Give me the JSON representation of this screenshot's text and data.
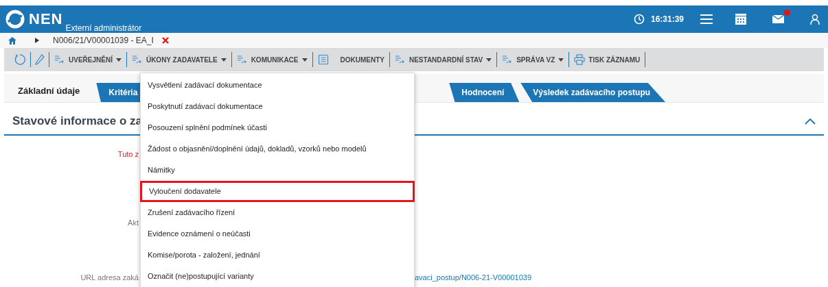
{
  "header": {
    "logo_text": "NEN",
    "subtitle": "Externí administrátor",
    "time": "16:31:39",
    "mail_unread": true
  },
  "breadcrumb": {
    "path": "N006/21/V00001039 - EA_I"
  },
  "toolbar": [
    {
      "kind": "refresh"
    },
    {
      "kind": "edit"
    },
    {
      "kind": "menu",
      "label": "UVEŘEJNĚNÍ"
    },
    {
      "kind": "menu",
      "label": "ÚKONY ZADAVATELE"
    },
    {
      "kind": "menu",
      "label": "KOMUNIKACE"
    },
    {
      "kind": "document",
      "label": "DOKUMENTY"
    },
    {
      "kind": "menu",
      "label": "NESTANDARDNÍ STAV"
    },
    {
      "kind": "menu",
      "label": "SPRÁVA VZ"
    },
    {
      "kind": "print",
      "label": "TISK ZÁZNAMU"
    }
  ],
  "tabs": [
    {
      "label": "Základní údaje",
      "selected": true
    },
    {
      "label": "Kritéria",
      "selected": false
    },
    {
      "label": "Hodnocení",
      "selected": false
    },
    {
      "label": "Výsledek zadávacího postupu",
      "selected": false
    }
  ],
  "section": {
    "title": "Stavové informace o za",
    "expanded": true
  },
  "fields": [
    {
      "kind": "warning",
      "label": "Tuto z"
    },
    {
      "kind": "label",
      "label": "Akt"
    },
    {
      "kind": "link",
      "label": "URL adresa zaká",
      "value": "avaci_postup/N006-21-V00001039"
    }
  ],
  "menu": [
    {
      "label": "Vysvětlení zadávací dokumentace",
      "selected": false
    },
    {
      "label": "Poskytnutí zadávací dokumentace",
      "selected": false
    },
    {
      "label": "Posouzení splnění podmínek účasti",
      "selected": false
    },
    {
      "label": "Žádost o objasnění/doplnění údajů, dokladů, vzorků nebo modelů",
      "selected": false
    },
    {
      "label": "Námitky",
      "selected": false
    },
    {
      "label": "Vyloučení dodavatele",
      "selected": true
    },
    {
      "label": "Zrušení zadávacího řízení",
      "selected": false
    },
    {
      "label": "Evidence oznámení o neúčasti",
      "selected": false
    },
    {
      "label": "Komise/porota - založení, jednání",
      "selected": false
    },
    {
      "label": "Označit (ne)postupující varianty",
      "selected": false
    }
  ]
}
